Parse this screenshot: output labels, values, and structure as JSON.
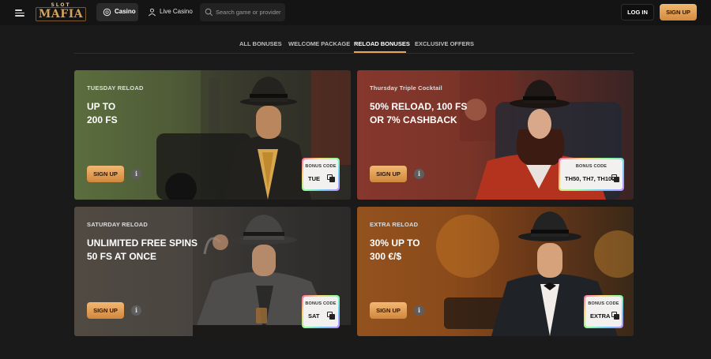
{
  "header": {
    "logo_top": "SLOT",
    "logo_main": "MAFIA",
    "nav": [
      {
        "label": "Casino",
        "icon": "poker-chip-icon",
        "active": true
      },
      {
        "label": "Live Casino",
        "icon": "dealer-icon",
        "active": false
      }
    ],
    "search": {
      "placeholder": "Search game or provider",
      "icon": "search-icon"
    },
    "login_label": "LOG IN",
    "signup_label": "SIGN UP"
  },
  "tabs": [
    {
      "label": "ALL BONUSES",
      "active": false
    },
    {
      "label": "WELCOME PACKAGE",
      "active": false
    },
    {
      "label": "RELOAD BONUSES",
      "active": true
    },
    {
      "label": "EXCLUSIVE OFFERS",
      "active": false
    }
  ],
  "cards": [
    {
      "label": "TUESDAY RELOAD",
      "title": "UP TO\n200 FS",
      "signup": "SIGN UP",
      "info": "i",
      "code_label": "BONUS CODE",
      "code": "TUE"
    },
    {
      "label": "Thursday Triple Cocktail",
      "title": "50% RELOAD, 100 FS\nOR 7% CASHBACK",
      "signup": "SIGN UP",
      "info": "i",
      "code_label": "BONUS CODE",
      "code": "TH50, TH7, TH100"
    },
    {
      "label": "SATURDAY RELOAD",
      "title": "UNLIMITED FREE SPINS\n50 FS AT ONCE",
      "signup": "SIGN UP",
      "info": "i",
      "code_label": "BONUS CODE",
      "code": "SAT"
    },
    {
      "label": "EXTRA RELOAD",
      "title": "30% UP TO\n300 €/$",
      "signup": "SIGN UP",
      "info": "i",
      "code_label": "BONUS CODE",
      "code": "EXTRA"
    }
  ],
  "colors": {
    "accent": "#e8a75a",
    "background": "#1a1a1a",
    "header": "#141414"
  }
}
